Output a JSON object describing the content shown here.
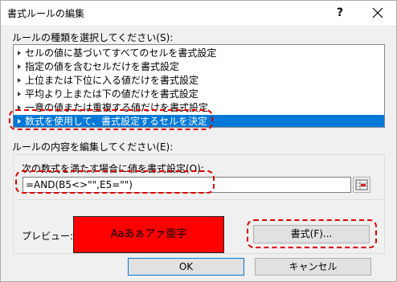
{
  "window": {
    "title": "書式ルールの編集",
    "help_label": "?",
    "close_icon": "close-icon"
  },
  "rule_type": {
    "label": "ルールの種類を選択してください(S):",
    "items": [
      "セルの値に基づいてすべてのセルを書式設定",
      "指定の値を含むセルだけを書式設定",
      "上位または下位に入る値だけを書式設定",
      "平均より上または下の値だけを書式設定",
      "一意の値または重複する値だけを書式設定",
      "数式を使用して、書式設定するセルを決定"
    ],
    "selected_index": 5
  },
  "rule_edit": {
    "label": "ルールの内容を編集してください(E):",
    "formula_label": "次の数式を満たす場合に値を書式設定(O):",
    "formula_value": "=AND(B5<>\"\",E5=\"\")",
    "preview_label": "プレビュー:",
    "preview_text": "Aaあぁアァ亜宇",
    "preview_color": "#ff0000",
    "format_button": "書式(F)..."
  },
  "buttons": {
    "ok": "OK",
    "cancel": "キャンセル"
  },
  "colors": {
    "selection": "#0078d7",
    "annotation": "#e00000"
  }
}
